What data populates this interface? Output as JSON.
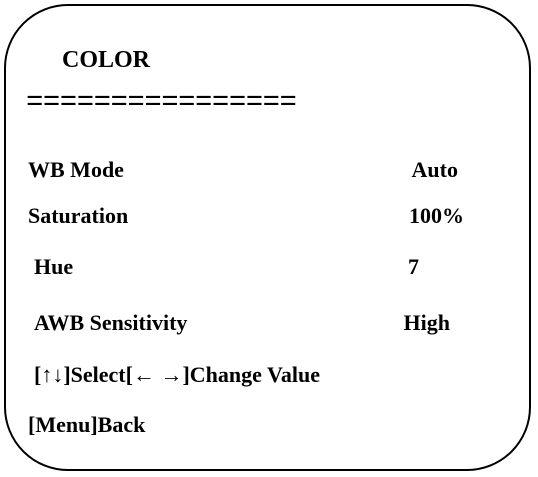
{
  "menu": {
    "title": "COLOR",
    "divider": "================",
    "items": [
      {
        "label": "WB Mode",
        "value": "Auto"
      },
      {
        "label": "Saturation",
        "value": "100%"
      },
      {
        "label": "Hue",
        "value": "7"
      },
      {
        "label": "AWB Sensitivity",
        "value": "High"
      }
    ],
    "help": {
      "select_hint": "[↑↓]Select[← →]Change Value",
      "back_hint": "[Menu]Back"
    }
  }
}
